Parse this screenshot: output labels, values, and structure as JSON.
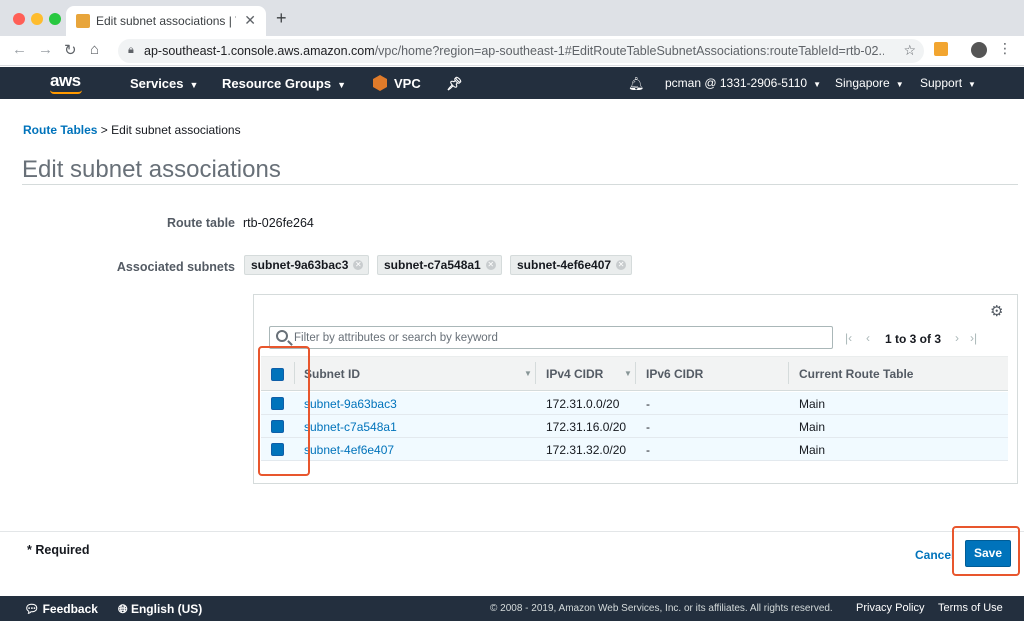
{
  "browser": {
    "tab_title": "Edit subnet associations | VPC",
    "tab_close": "✕",
    "new_tab": "+",
    "url_host": "ap-southeast-1.console.aws.amazon.com",
    "url_path": "/vpc/home?region=ap-southeast-1#EditRouteTableSubnetAssociations:routeTableId=rtb-02..."
  },
  "nav": {
    "brand": "aws",
    "services": "Services",
    "resource_groups": "Resource Groups",
    "vpc": "VPC",
    "account": "pcman @ 1331-2906-5110",
    "region": "Singapore",
    "support": "Support"
  },
  "breadcrumb": {
    "root": "Route Tables",
    "separator": " > ",
    "current": "Edit subnet associations"
  },
  "page_title": "Edit subnet associations",
  "route_table": {
    "label": "Route table",
    "value": "rtb-026fe264"
  },
  "associated_subnets": {
    "label": "Associated subnets",
    "chips": [
      "subnet-9a63bac3",
      "subnet-c7a548a1",
      "subnet-4ef6e407"
    ]
  },
  "filter": {
    "placeholder": "Filter by attributes or search by keyword"
  },
  "pager": {
    "text": "1 to 3 of 3"
  },
  "table": {
    "columns": [
      "Subnet ID",
      "IPv4 CIDR",
      "IPv6 CIDR",
      "Current Route Table"
    ],
    "rows": [
      {
        "subnet_id": "subnet-9a63bac3",
        "ipv4": "172.31.0.0/20",
        "ipv6": "-",
        "route_table": "Main"
      },
      {
        "subnet_id": "subnet-c7a548a1",
        "ipv4": "172.31.16.0/20",
        "ipv6": "-",
        "route_table": "Main"
      },
      {
        "subnet_id": "subnet-4ef6e407",
        "ipv4": "172.31.32.0/20",
        "ipv6": "-",
        "route_table": "Main"
      }
    ]
  },
  "form_footer": {
    "required": "* Required",
    "cancel": "Cancel",
    "save": "Save"
  },
  "footer": {
    "feedback": "Feedback",
    "language": "English (US)",
    "copyright": "© 2008 - 2019, Amazon Web Services, Inc. or its affiliates. All rights reserved.",
    "privacy": "Privacy Policy",
    "terms": "Terms of Use"
  },
  "colors": {
    "accent": "#0073bb",
    "nav_bg": "#232f3e",
    "highlight": "#e8562d",
    "aws_orange": "#ff9900"
  }
}
